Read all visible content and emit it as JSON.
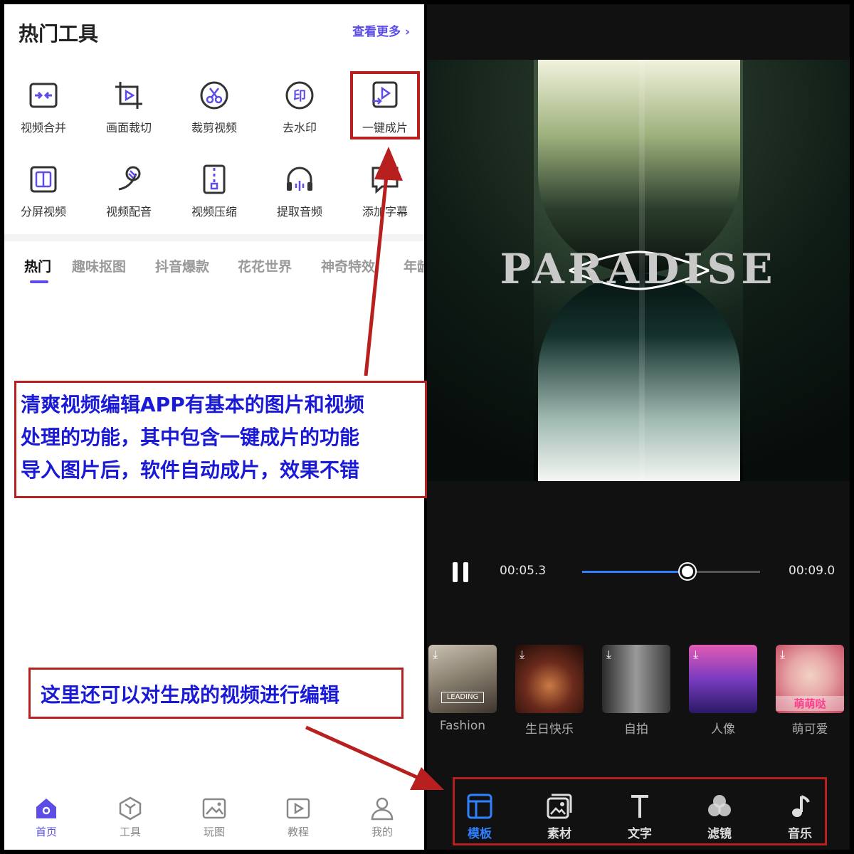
{
  "left": {
    "title": "热门工具",
    "see_more": "查看更多 ›",
    "tools": [
      {
        "label": "视频合并",
        "icon": "merge-video-icon"
      },
      {
        "label": "画面裁切",
        "icon": "crop-icon"
      },
      {
        "label": "裁剪视频",
        "icon": "scissors-icon"
      },
      {
        "label": "去水印",
        "icon": "remove-watermark-icon"
      },
      {
        "label": "一键成片",
        "icon": "one-click-video-icon"
      },
      {
        "label": "分屏视频",
        "icon": "split-screen-icon"
      },
      {
        "label": "视频配音",
        "icon": "dubbing-icon"
      },
      {
        "label": "视频压缩",
        "icon": "compress-icon"
      },
      {
        "label": "提取音频",
        "icon": "extract-audio-icon"
      },
      {
        "label": "添加字幕",
        "icon": "subtitle-icon"
      }
    ],
    "tabs": [
      "热门",
      "趣味抠图",
      "抖音爆款",
      "花花世界",
      "神奇特效",
      "年龄"
    ],
    "active_tab": "热门",
    "bottom_nav": [
      {
        "label": "首页",
        "icon": "home-icon",
        "active": true
      },
      {
        "label": "工具",
        "icon": "cube-icon",
        "active": false
      },
      {
        "label": "玩图",
        "icon": "image-icon",
        "active": false
      },
      {
        "label": "教程",
        "icon": "play-tutorial-icon",
        "active": false
      },
      {
        "label": "我的",
        "icon": "profile-icon",
        "active": false
      }
    ]
  },
  "right": {
    "preview_text": "PARADISE",
    "current_time": "00:05.3",
    "total_time": "00:09.0",
    "progress_fraction": 0.59,
    "templates": [
      {
        "label": "Fashion",
        "badge": "LEADING"
      },
      {
        "label": "生日快乐"
      },
      {
        "label": "自拍"
      },
      {
        "label": "人像"
      },
      {
        "label": "萌可爱",
        "badge": "萌萌哒"
      }
    ],
    "toolbar": [
      {
        "label": "模板",
        "icon": "template-icon",
        "active": true
      },
      {
        "label": "素材",
        "icon": "material-icon",
        "active": false
      },
      {
        "label": "文字",
        "icon": "text-icon",
        "active": false
      },
      {
        "label": "滤镜",
        "icon": "filter-icon",
        "active": false
      },
      {
        "label": "音乐",
        "icon": "music-icon",
        "active": false
      }
    ]
  },
  "annotations": {
    "note1": [
      "清爽视频编辑APP有基本的图片和视频",
      "处理的功能，其中包含一键成片的功能",
      "导入图片后，软件自动成片，效果不错"
    ],
    "note2": "这里还可以对生成的视频进行编辑"
  },
  "colors": {
    "accent_purple": "#5b4de6",
    "accent_blue": "#2f82ff",
    "annotation_red": "#b8201f",
    "annotation_text": "#1a1ad6"
  }
}
